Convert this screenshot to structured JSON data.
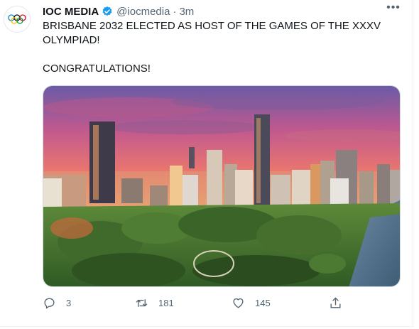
{
  "tweet": {
    "display_name": "IOC MEDIA",
    "handle": "@iocmedia",
    "separator": "·",
    "time": "3m",
    "text_line1": "BRISBANE 2032 ELECTED AS HOST OF THE GAMES OF THE XXXV OLYMPIAD!",
    "text_line2": "CONGRATULATIONS!",
    "more_label": "•••",
    "media_description": "Sunset aerial photo of Brisbane city skyline with park in foreground",
    "icons": {
      "avatar": "olympic-rings-icon",
      "verified": "verified-badge-icon",
      "reply": "reply-icon",
      "retweet": "retweet-icon",
      "like": "like-icon",
      "share": "share-icon"
    }
  },
  "actions": {
    "reply_count": "3",
    "retweet_count": "181",
    "like_count": "145"
  },
  "colors": {
    "verified": "#1d9bf0",
    "secondary_text": "#536471",
    "ring_blue": "#0085c7",
    "ring_yellow": "#f4c300",
    "ring_black": "#000000",
    "ring_green": "#009f3d",
    "ring_red": "#df0024"
  }
}
